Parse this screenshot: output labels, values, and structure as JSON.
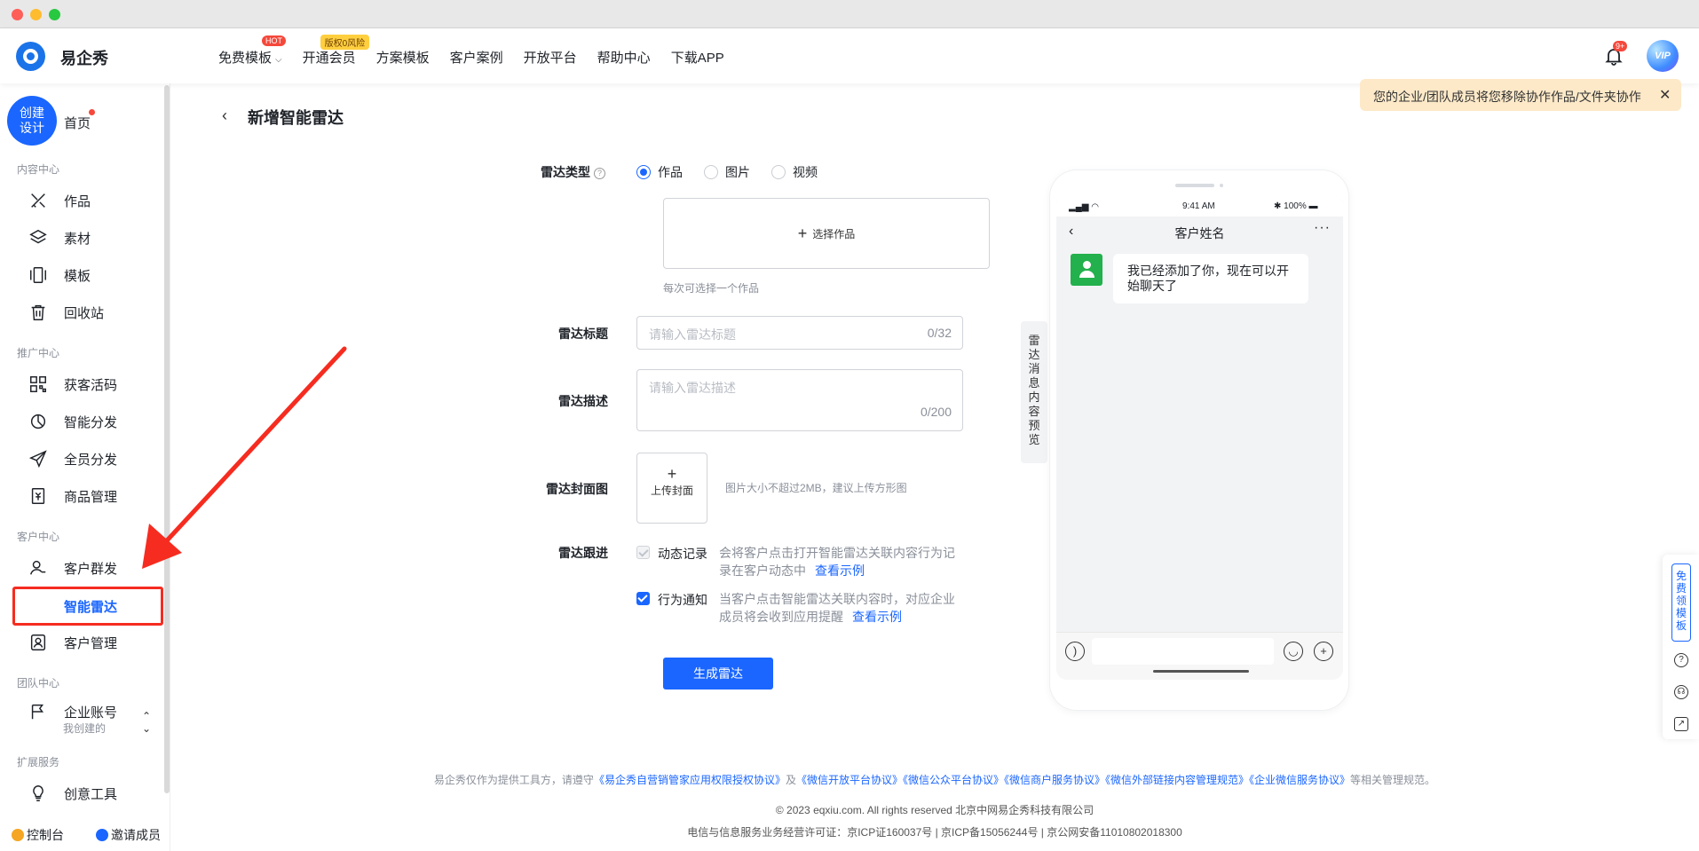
{
  "brand": "易企秀",
  "nav": {
    "items": [
      "免费模板",
      "开通会员",
      "方案模板",
      "客户案例",
      "开放平台",
      "帮助中心",
      "下载APP"
    ],
    "hot_badge": "HOT",
    "vip_badge": "版权0风险",
    "bell_count": "9+",
    "avatar_label": "VIP"
  },
  "notice": {
    "text": "您的企业/团队成员将您移除协作作品/文件夹协作"
  },
  "sidebar": {
    "create_label": "创建\n设计",
    "home": "首页",
    "sections": [
      "内容中心",
      "推广中心",
      "客户中心",
      "团队中心",
      "扩展服务"
    ],
    "items": [
      "作品",
      "素材",
      "模板",
      "回收站",
      "获客活码",
      "智能分发",
      "全员分发",
      "商品管理",
      "客户群发",
      "智能雷达",
      "客户管理",
      "企业账号",
      "创意工具"
    ],
    "account_sub": "我创建的",
    "console": "控制台",
    "invite": "邀请成员"
  },
  "page": {
    "title": "新增智能雷达",
    "type_label": "雷达类型",
    "type_options": [
      "作品",
      "图片",
      "视频"
    ],
    "choose_work": "选择作品",
    "choose_hint": "每次可选择一个作品",
    "title_label": "雷达标题",
    "title_placeholder": "请输入雷达标题",
    "title_count": "0/32",
    "desc_label": "雷达描述",
    "desc_placeholder": "请输入雷达描述",
    "desc_count": "0/200",
    "cover_label": "雷达封面图",
    "upload_cover": "上传封面",
    "cover_hint": "图片大小不超过2MB，建议上传方形图",
    "track_label": "雷达跟进",
    "track": [
      {
        "label": "动态记录",
        "desc": "会将客户点击打开智能雷达关联内容行为记录在客户动态中",
        "link": "查看示例"
      },
      {
        "label": "行为通知",
        "desc": "当客户点击智能雷达关联内容时，对应企业成员将会收到应用提醒",
        "link": "查看示例"
      }
    ],
    "submit": "生成雷达"
  },
  "preview": {
    "tab": "雷达消息内容预览",
    "time": "9:41 AM",
    "battery": "100%",
    "chat_title": "客户姓名",
    "message": "我已经添加了你，现在可以开始聊天了"
  },
  "floatpanel": {
    "free": "免费领模板"
  },
  "footer": {
    "pre": "易企秀仅作为提供工具方，请遵守",
    "links": [
      "《易企秀自营销管家应用权限授权协议》",
      "《微信开放平台协议》",
      "《微信公众平台协议》",
      "《微信商户服务协议》",
      "《微信外部链接内容管理规范》",
      "《企业微信服务协议》"
    ],
    "and": "及",
    "post": "等相关管理规范。",
    "copyright": "© 2023 eqxiu.com. All rights reserved 北京中网易企秀科技有限公司",
    "icp": "电信与信息服务业务经营许可证：京ICP证160037号 | 京ICP备15056244号 | 京公网安备11010802018300"
  }
}
